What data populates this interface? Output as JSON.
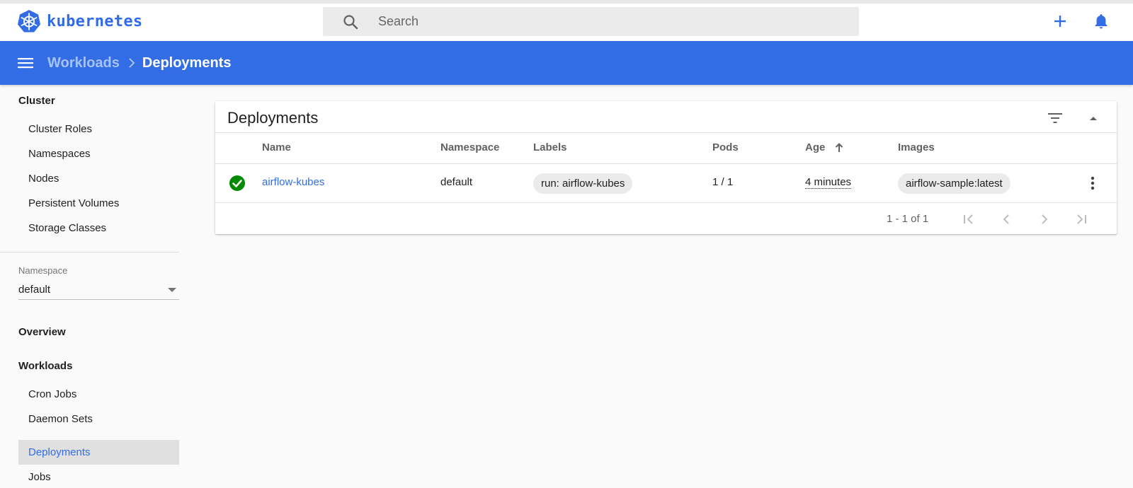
{
  "app": {
    "logo_text": "kubernetes",
    "brand_color": "#326de6"
  },
  "search": {
    "placeholder": "Search",
    "icon": "search-icon"
  },
  "top_actions": [
    {
      "name": "create",
      "icon": "plus-icon"
    },
    {
      "name": "notifications",
      "icon": "bell-icon"
    }
  ],
  "breadcrumb": {
    "parent": "Workloads",
    "current": "Deployments"
  },
  "sidebar": {
    "cluster_header": "Cluster",
    "cluster_items": [
      "Cluster Roles",
      "Namespaces",
      "Nodes",
      "Persistent Volumes",
      "Storage Classes"
    ],
    "namespace_label": "Namespace",
    "namespace_value": "default",
    "overview_header": "Overview",
    "workloads_header": "Workloads",
    "workloads_items": [
      "Cron Jobs",
      "Daemon Sets",
      "Deployments",
      "Jobs"
    ],
    "active_item": "Deployments"
  },
  "card": {
    "title": "Deployments",
    "columns": {
      "name": "Name",
      "namespace": "Namespace",
      "labels": "Labels",
      "pods": "Pods",
      "age": "Age",
      "images": "Images"
    },
    "sort_indicator": "arrow-up-icon",
    "rows": [
      {
        "status": "ok",
        "name": "airflow-kubes",
        "namespace": "default",
        "label": "run: airflow-kubes",
        "pods": "1 / 1",
        "age": "4 minutes",
        "image": "airflow-sample:latest"
      }
    ],
    "pagination": {
      "range": "1 - 1 of 1"
    }
  }
}
